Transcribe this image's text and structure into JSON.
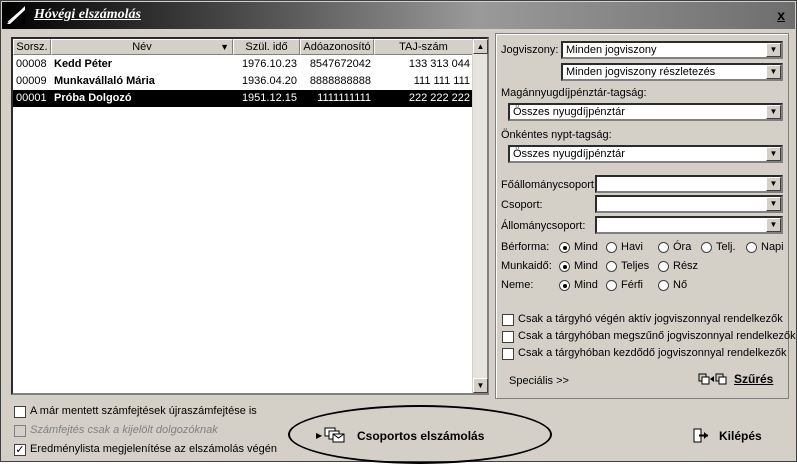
{
  "window": {
    "title": "Hóvégi elszámolás",
    "close": "x"
  },
  "list": {
    "columns": [
      "Sorsz.",
      "Név",
      "Szül. idő",
      "Adóazonosító",
      "TAJ-szám"
    ],
    "rows": [
      {
        "no": "00008",
        "name": "Kedd Péter",
        "birth": "1976.10.23",
        "tax": "8547672042",
        "taj": "133 313 044",
        "selected": false
      },
      {
        "no": "00009",
        "name": "Munkavállaló Mária",
        "birth": "1936.04.20",
        "tax": "8888888888",
        "taj": "111 111 111",
        "selected": false
      },
      {
        "no": "00001",
        "name": "Próba Dolgozó",
        "birth": "1951.12.15",
        "tax": "1111111111",
        "taj": "222 222 222",
        "selected": true
      }
    ]
  },
  "filters": {
    "jogviszony_label": "Jogviszony:",
    "jogviszony_value": "Minden jogviszony",
    "jogviszony_detail_value": "Minden jogviszony részletezés",
    "magan_label": "Magánnyugdíjpénztár-tagság:",
    "magan_value": "Összes nyugdíjpénztár",
    "onkentes_label": "Önkéntes nypt-tagság:",
    "onkentes_value": "Összes nyugdíjpénztár",
    "foallomany_label": "Főállománycsoport:",
    "foallomany_value": "",
    "csoport_label": "Csoport:",
    "csoport_value": "",
    "allomany_label": "Állománycsoport:",
    "allomany_value": "",
    "berforma_label": "Bérforma:",
    "berforma_options": [
      "Mind",
      "Havi",
      "Óra",
      "Telj.",
      "Napi"
    ],
    "munkaido_label": "Munkaidő:",
    "munkaido_options": [
      "Mind",
      "Teljes",
      "Rész"
    ],
    "neme_label": "Neme:",
    "neme_options": [
      "Mind",
      "Férfi",
      "Nő"
    ],
    "chk_aktiv": "Csak a tárgyhó végén aktív jogviszonnyal rendelkezők",
    "chk_megszuno": "Csak a tárgyhóban megszűnő jogviszonnyal rendelkezők",
    "chk_kezdodo": "Csak a tárgyhóban kezdődő jogviszonnyal rendelkezők",
    "specialis": "Speciális >>",
    "szures": "Szűrés"
  },
  "options": {
    "recalc": "A már mentett számfejtések újraszámfejtése is",
    "selected_only": "Számfejtés csak a kijelölt dolgozóknak",
    "result_list": "Eredménylista megjelenítése az elszámolás végén"
  },
  "actions": {
    "group": "Csoportos elszámolás",
    "exit": "Kilépés"
  }
}
